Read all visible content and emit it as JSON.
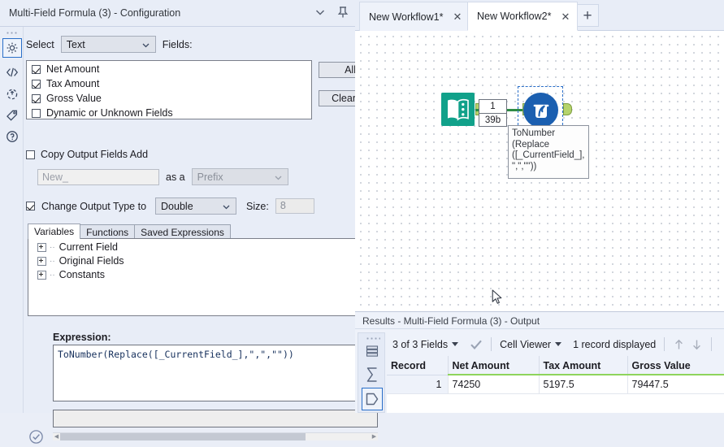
{
  "config": {
    "title": "Multi-Field Formula (3) - Configuration",
    "collapse_icon": "chevron-down-icon",
    "pin_icon": "pin-icon",
    "rail_icons": [
      "gear-icon",
      "code-icon",
      "refresh-arrow-icon",
      "tag-icon",
      "question-icon"
    ],
    "select_label": "Select",
    "type_filter": "Text",
    "fields_label": "Fields:",
    "fields": [
      {
        "label": "Net Amount",
        "checked": true
      },
      {
        "label": "Tax Amount",
        "checked": true
      },
      {
        "label": "Gross Value",
        "checked": true
      },
      {
        "label": "Dynamic or Unknown Fields",
        "checked": false
      }
    ],
    "all_button": "All",
    "clear_button": "Clear",
    "copy_output_label": "Copy Output Fields Add",
    "copy_output_checked": false,
    "new_field_placeholder": "New_",
    "as_a_label": "as a",
    "prefix_value": "Prefix",
    "change_type_label": "Change Output Type to",
    "change_type_checked": true,
    "output_type": "Double",
    "size_label": "Size:",
    "size_value": "8",
    "tabs": [
      "Variables",
      "Functions",
      "Saved Expressions"
    ],
    "active_tab": "Variables",
    "tree_nodes": [
      "Current Field",
      "Original Fields",
      "Constants"
    ],
    "expression_label": "Expression:",
    "expression": "ToNumber(Replace([_CurrentField_],\",\",\"\"))",
    "message_text": ""
  },
  "workflow": {
    "tabs": [
      {
        "label": "New Workflow1*",
        "active": false,
        "close_icon": "close-icon"
      },
      {
        "label": "New Workflow2*",
        "active": true,
        "close_icon": "close-icon"
      }
    ],
    "add_tab_icon": "plus-icon",
    "canvas": {
      "input_node_icon": "input-data-book-icon",
      "tool_node_icon": "multi-field-formula-beaker-icon",
      "connection_records": "1",
      "connection_size": "39b",
      "annotation": "ToNumber\n(Replace\n([_CurrentField_],\n\",\",\"\"))",
      "cursor_icon": "mouse-pointer-icon"
    }
  },
  "results": {
    "title": "Results - Multi-Field Formula (3) - Output",
    "rail_icons": [
      "rows-icon",
      "sigma-icon",
      "output-shape-icon"
    ],
    "fields_selector": "3 of 3 Fields",
    "checkmark_icon": "checkmark-icon",
    "viewer_mode": "Cell Viewer",
    "record_count": "1 record displayed",
    "up_icon": "arrow-up-icon",
    "down_icon": "arrow-down-icon",
    "columns": [
      "Record",
      "Net Amount",
      "Tax Amount",
      "Gross Value"
    ],
    "rows": [
      {
        "record": "1",
        "net_amount": "74250",
        "tax_amount": "5197.5",
        "gross_value": "79447.5"
      }
    ]
  },
  "colors": {
    "accent_blue": "#2a6fc9",
    "panel_bg": "#e8edf7",
    "input_tool_teal": "#11a18a",
    "tool_blue": "#1b5fb0",
    "wire_green": "#2e8b45",
    "header_underline_green": "#8ed45c"
  }
}
